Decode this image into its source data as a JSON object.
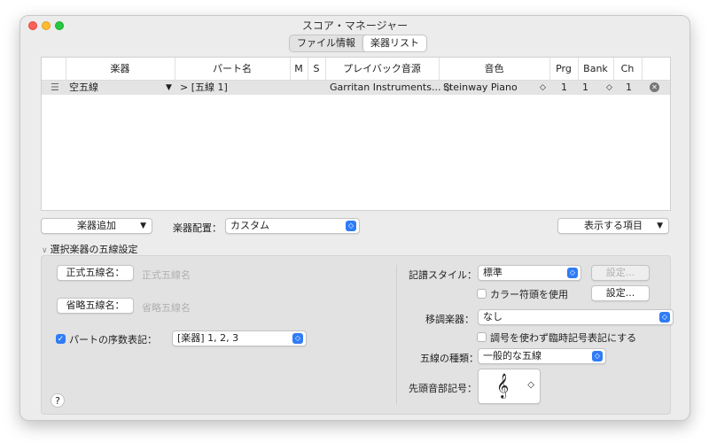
{
  "window": {
    "title": "スコア・マネージャー"
  },
  "tabs": [
    {
      "label": "ファイル情報"
    },
    {
      "label": "楽器リスト"
    }
  ],
  "table": {
    "columns": [
      "楽器",
      "パート名",
      "M",
      "S",
      "プレイバック音源",
      "音色",
      "Prg",
      "Bank",
      "Ch"
    ],
    "row": {
      "instrument": "空五線",
      "part": "> [五線 1]",
      "playback": "Garritan Instruments... ◇",
      "sound": "Steinway Piano",
      "prg": "1",
      "bank": "1",
      "ch": "1"
    }
  },
  "controls": {
    "add_instrument": "楽器追加",
    "placement_label": "楽器配置：",
    "placement_value": "カスタム",
    "show_items": "表示する項目"
  },
  "section": {
    "title": "選択楽器の五線設定"
  },
  "left": {
    "full_name_btn": "正式五線名：",
    "full_name_placeholder": "正式五線名",
    "abbr_name_btn": "省略五線名：",
    "abbr_name_placeholder": "省略五線名",
    "ordinal_label": "パートの序数表記：",
    "ordinal_value": "[楽器] 1, 2, 3",
    "help": "?"
  },
  "right": {
    "notation_label": "記譜スタイル：",
    "notation_value": "標準",
    "settings_disabled": "設定...",
    "color_noteheads": "カラー符頭を使用",
    "settings": "設定...",
    "transposition_label": "移調楽器：",
    "transposition_value": "なし",
    "key_sig_option": "調号を使わず臨時記号表記にする",
    "staff_type_label": "五線の種類：",
    "staff_type_value": "一般的な五線",
    "clef_label": "先頭音部記号：",
    "clef_symbol": "𝄞"
  }
}
